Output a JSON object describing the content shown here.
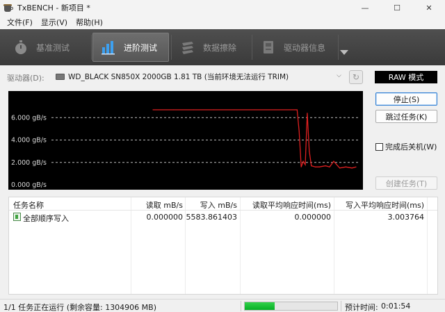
{
  "window": {
    "title": "TxBENCH - 新项目 *",
    "controls": [
      "—",
      "☐",
      "✕"
    ]
  },
  "menu": {
    "items": [
      "文件(F)",
      "显示(V)",
      "帮助(H)"
    ]
  },
  "toolbar": {
    "tabs": [
      {
        "label": "基准测试",
        "icon": "stopwatch-icon",
        "active": false
      },
      {
        "label": "进阶测试",
        "icon": "bar-chart-icon",
        "active": true
      },
      {
        "label": "数据擦除",
        "icon": "eraser-icon",
        "active": false
      },
      {
        "label": "驱动器信息",
        "icon": "drive-info-icon",
        "active": false
      }
    ]
  },
  "drive": {
    "label": "驱动器(D):",
    "selected": "WD_BLACK SN850X 2000GB  1.81 TB (当前环境无法运行 TRIM)",
    "mode": "RAW 模式"
  },
  "chart_data": {
    "type": "line",
    "title": "",
    "xlabel": "",
    "ylabel": "",
    "y_tick_labels": [
      "6.000 gB/s",
      "4.000 gB/s",
      "2.000 gB/s",
      "0.000 gB/s"
    ],
    "y_ticks": [
      6,
      4,
      2,
      0
    ],
    "ylim": [
      0,
      8
    ],
    "grid": true,
    "series": [
      {
        "color": "#e02020",
        "x": [
          0,
          10,
          20,
          30,
          40,
          50,
          60,
          70,
          71,
          72,
          73,
          74,
          75,
          76,
          77,
          78,
          80,
          82,
          85,
          87,
          89,
          92,
          95,
          98,
          100
        ],
        "values": [
          6.7,
          6.7,
          6.7,
          6.7,
          6.7,
          6.7,
          6.7,
          6.7,
          6.7,
          4.8,
          1.6,
          2.1,
          1.8,
          6.4,
          3.0,
          1.7,
          1.6,
          1.6,
          1.7,
          1.6,
          2.1,
          1.5,
          1.6,
          1.5,
          1.6
        ]
      }
    ]
  },
  "buttons": {
    "stop": "停止(S)",
    "skip": "跳过任务(K)",
    "shutdown": "完成后关机(W)",
    "create": "创建任务(T)"
  },
  "table": {
    "headers": [
      "任务名称",
      "读取 mB/s",
      "写入 mB/s",
      "读取平均响应时间(ms)",
      "写入平均响应时间(ms)"
    ],
    "rows": [
      {
        "name": "全部顺序写入",
        "read": "0.000000",
        "write": "5583.861403",
        "read_latency": "0.000000",
        "write_latency": "3.003764"
      }
    ]
  },
  "status": {
    "text": "1/1 任务正在运行 (剩余容量: 1304906 MB)",
    "progress": 0.32,
    "eta_label": "预计时间:",
    "eta_value": "0:01:54"
  },
  "colors": {
    "toolbar_bg": "#444444",
    "chart_bg": "#000000",
    "series": "#e02020",
    "progress": "#06b025",
    "accent": "#2a7bd4"
  }
}
